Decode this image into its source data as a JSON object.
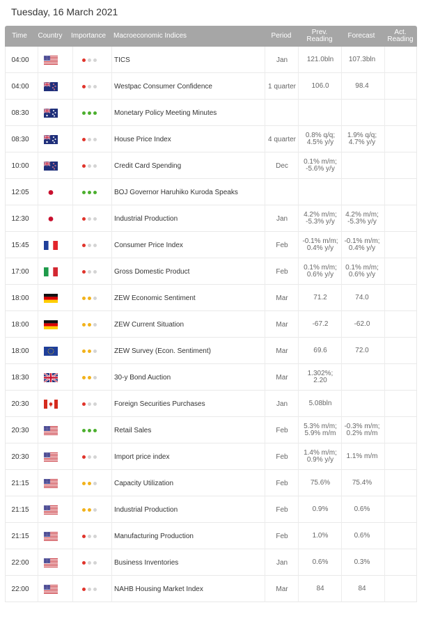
{
  "date_label": "Tuesday, 16 March 2021",
  "headers": {
    "time": "Time",
    "country": "Country",
    "importance": "Importance",
    "indices": "Macroeconomic Indices",
    "period": "Period",
    "prev": "Prev.\nReading",
    "forecast": "Forecast",
    "actual": "Act.\nReading"
  },
  "colors": {
    "high": "#4caf2e",
    "medium": "#f2b21b",
    "low_red": "#e0342b",
    "off": "#d4d4d4"
  },
  "rows": [
    {
      "time": "04:00",
      "country": "US",
      "importance": 1,
      "name": "TICS",
      "period": "Jan",
      "prev": "121.0bln",
      "forecast": "107.3bln",
      "actual": ""
    },
    {
      "time": "04:00",
      "country": "NZ",
      "importance": 1,
      "name": "Westpac Consumer Confidence",
      "period": "1 quarter",
      "prev": "106.0",
      "forecast": "98.4",
      "actual": ""
    },
    {
      "time": "08:30",
      "country": "AU",
      "importance": 3,
      "name": "Monetary Policy Meeting Minutes",
      "period": "",
      "prev": "",
      "forecast": "",
      "actual": ""
    },
    {
      "time": "08:30",
      "country": "AU",
      "importance": 1,
      "name": "House Price Index",
      "period": "4 quarter",
      "prev": "0.8% q/q;\n4.5% y/y",
      "forecast": "1.9% q/q;\n4.7% y/y",
      "actual": ""
    },
    {
      "time": "10:00",
      "country": "NZ",
      "importance": 1,
      "name": "Credit Card Spending",
      "period": "Dec",
      "prev": "0.1% m/m;\n-5.6% y/y",
      "forecast": "",
      "actual": ""
    },
    {
      "time": "12:05",
      "country": "JP",
      "importance": 3,
      "name": "BOJ Governor Haruhiko Kuroda Speaks",
      "period": "",
      "prev": "",
      "forecast": "",
      "actual": ""
    },
    {
      "time": "12:30",
      "country": "JP",
      "importance": 1,
      "name": "Industrial Production",
      "period": "Jan",
      "prev": "4.2% m/m;\n-5.3% y/y",
      "forecast": "4.2% m/m;\n-5.3% y/y",
      "actual": ""
    },
    {
      "time": "15:45",
      "country": "FR",
      "importance": 1,
      "name": "Consumer Price Index",
      "period": "Feb",
      "prev": "-0.1% m/m;\n0.4% y/y",
      "forecast": "-0.1% m/m;\n0.4% y/y",
      "actual": ""
    },
    {
      "time": "17:00",
      "country": "IT",
      "importance": 1,
      "name": "Gross Domestic Product",
      "period": "Feb",
      "prev": "0.1% m/m;\n0.6% y/y",
      "forecast": "0.1% m/m;\n0.6% y/y",
      "actual": ""
    },
    {
      "time": "18:00",
      "country": "DE",
      "importance": 2,
      "name": "ZEW Economic Sentiment",
      "period": "Mar",
      "prev": "71.2",
      "forecast": "74.0",
      "actual": ""
    },
    {
      "time": "18:00",
      "country": "DE",
      "importance": 2,
      "name": "ZEW Current Situation",
      "period": "Mar",
      "prev": "-67.2",
      "forecast": "-62.0",
      "actual": ""
    },
    {
      "time": "18:00",
      "country": "EU",
      "importance": 2,
      "name": "ZEW Survey (Econ. Sentiment)",
      "period": "Mar",
      "prev": "69.6",
      "forecast": "72.0",
      "actual": ""
    },
    {
      "time": "18:30",
      "country": "GB",
      "importance": 2,
      "name": "30-y Bond Auction",
      "period": "Mar",
      "prev": "1.302%;\n2.20",
      "forecast": "",
      "actual": ""
    },
    {
      "time": "20:30",
      "country": "CA",
      "importance": 1,
      "name": "Foreign Securities Purchases",
      "period": "Jan",
      "prev": "5.08bln",
      "forecast": "",
      "actual": ""
    },
    {
      "time": "20:30",
      "country": "US",
      "importance": 3,
      "name": "Retail Sales",
      "period": "Feb",
      "prev": "5.3% m/m;\n5.9% m/m",
      "forecast": "-0.3% m/m;\n0.2% m/m",
      "actual": ""
    },
    {
      "time": "20:30",
      "country": "US",
      "importance": 1,
      "name": "Import price index",
      "period": "Feb",
      "prev": "1.4% m/m;\n0.9% y/y",
      "forecast": "1.1% m/m",
      "actual": ""
    },
    {
      "time": "21:15",
      "country": "US",
      "importance": 2,
      "name": "Capacity Utilization",
      "period": "Feb",
      "prev": "75.6%",
      "forecast": "75.4%",
      "actual": ""
    },
    {
      "time": "21:15",
      "country": "US",
      "importance": 2,
      "name": "Industrial Production",
      "period": "Feb",
      "prev": "0.9%",
      "forecast": "0.6%",
      "actual": ""
    },
    {
      "time": "21:15",
      "country": "US",
      "importance": 1,
      "name": "Manufacturing Production",
      "period": "Feb",
      "prev": "1.0%",
      "forecast": "0.6%",
      "actual": ""
    },
    {
      "time": "22:00",
      "country": "US",
      "importance": 1,
      "name": "Business Inventories",
      "period": "Jan",
      "prev": "0.6%",
      "forecast": "0.3%",
      "actual": ""
    },
    {
      "time": "22:00",
      "country": "US",
      "importance": 1,
      "name": "NAHB Housing Market Index",
      "period": "Mar",
      "prev": "84",
      "forecast": "84",
      "actual": ""
    }
  ]
}
